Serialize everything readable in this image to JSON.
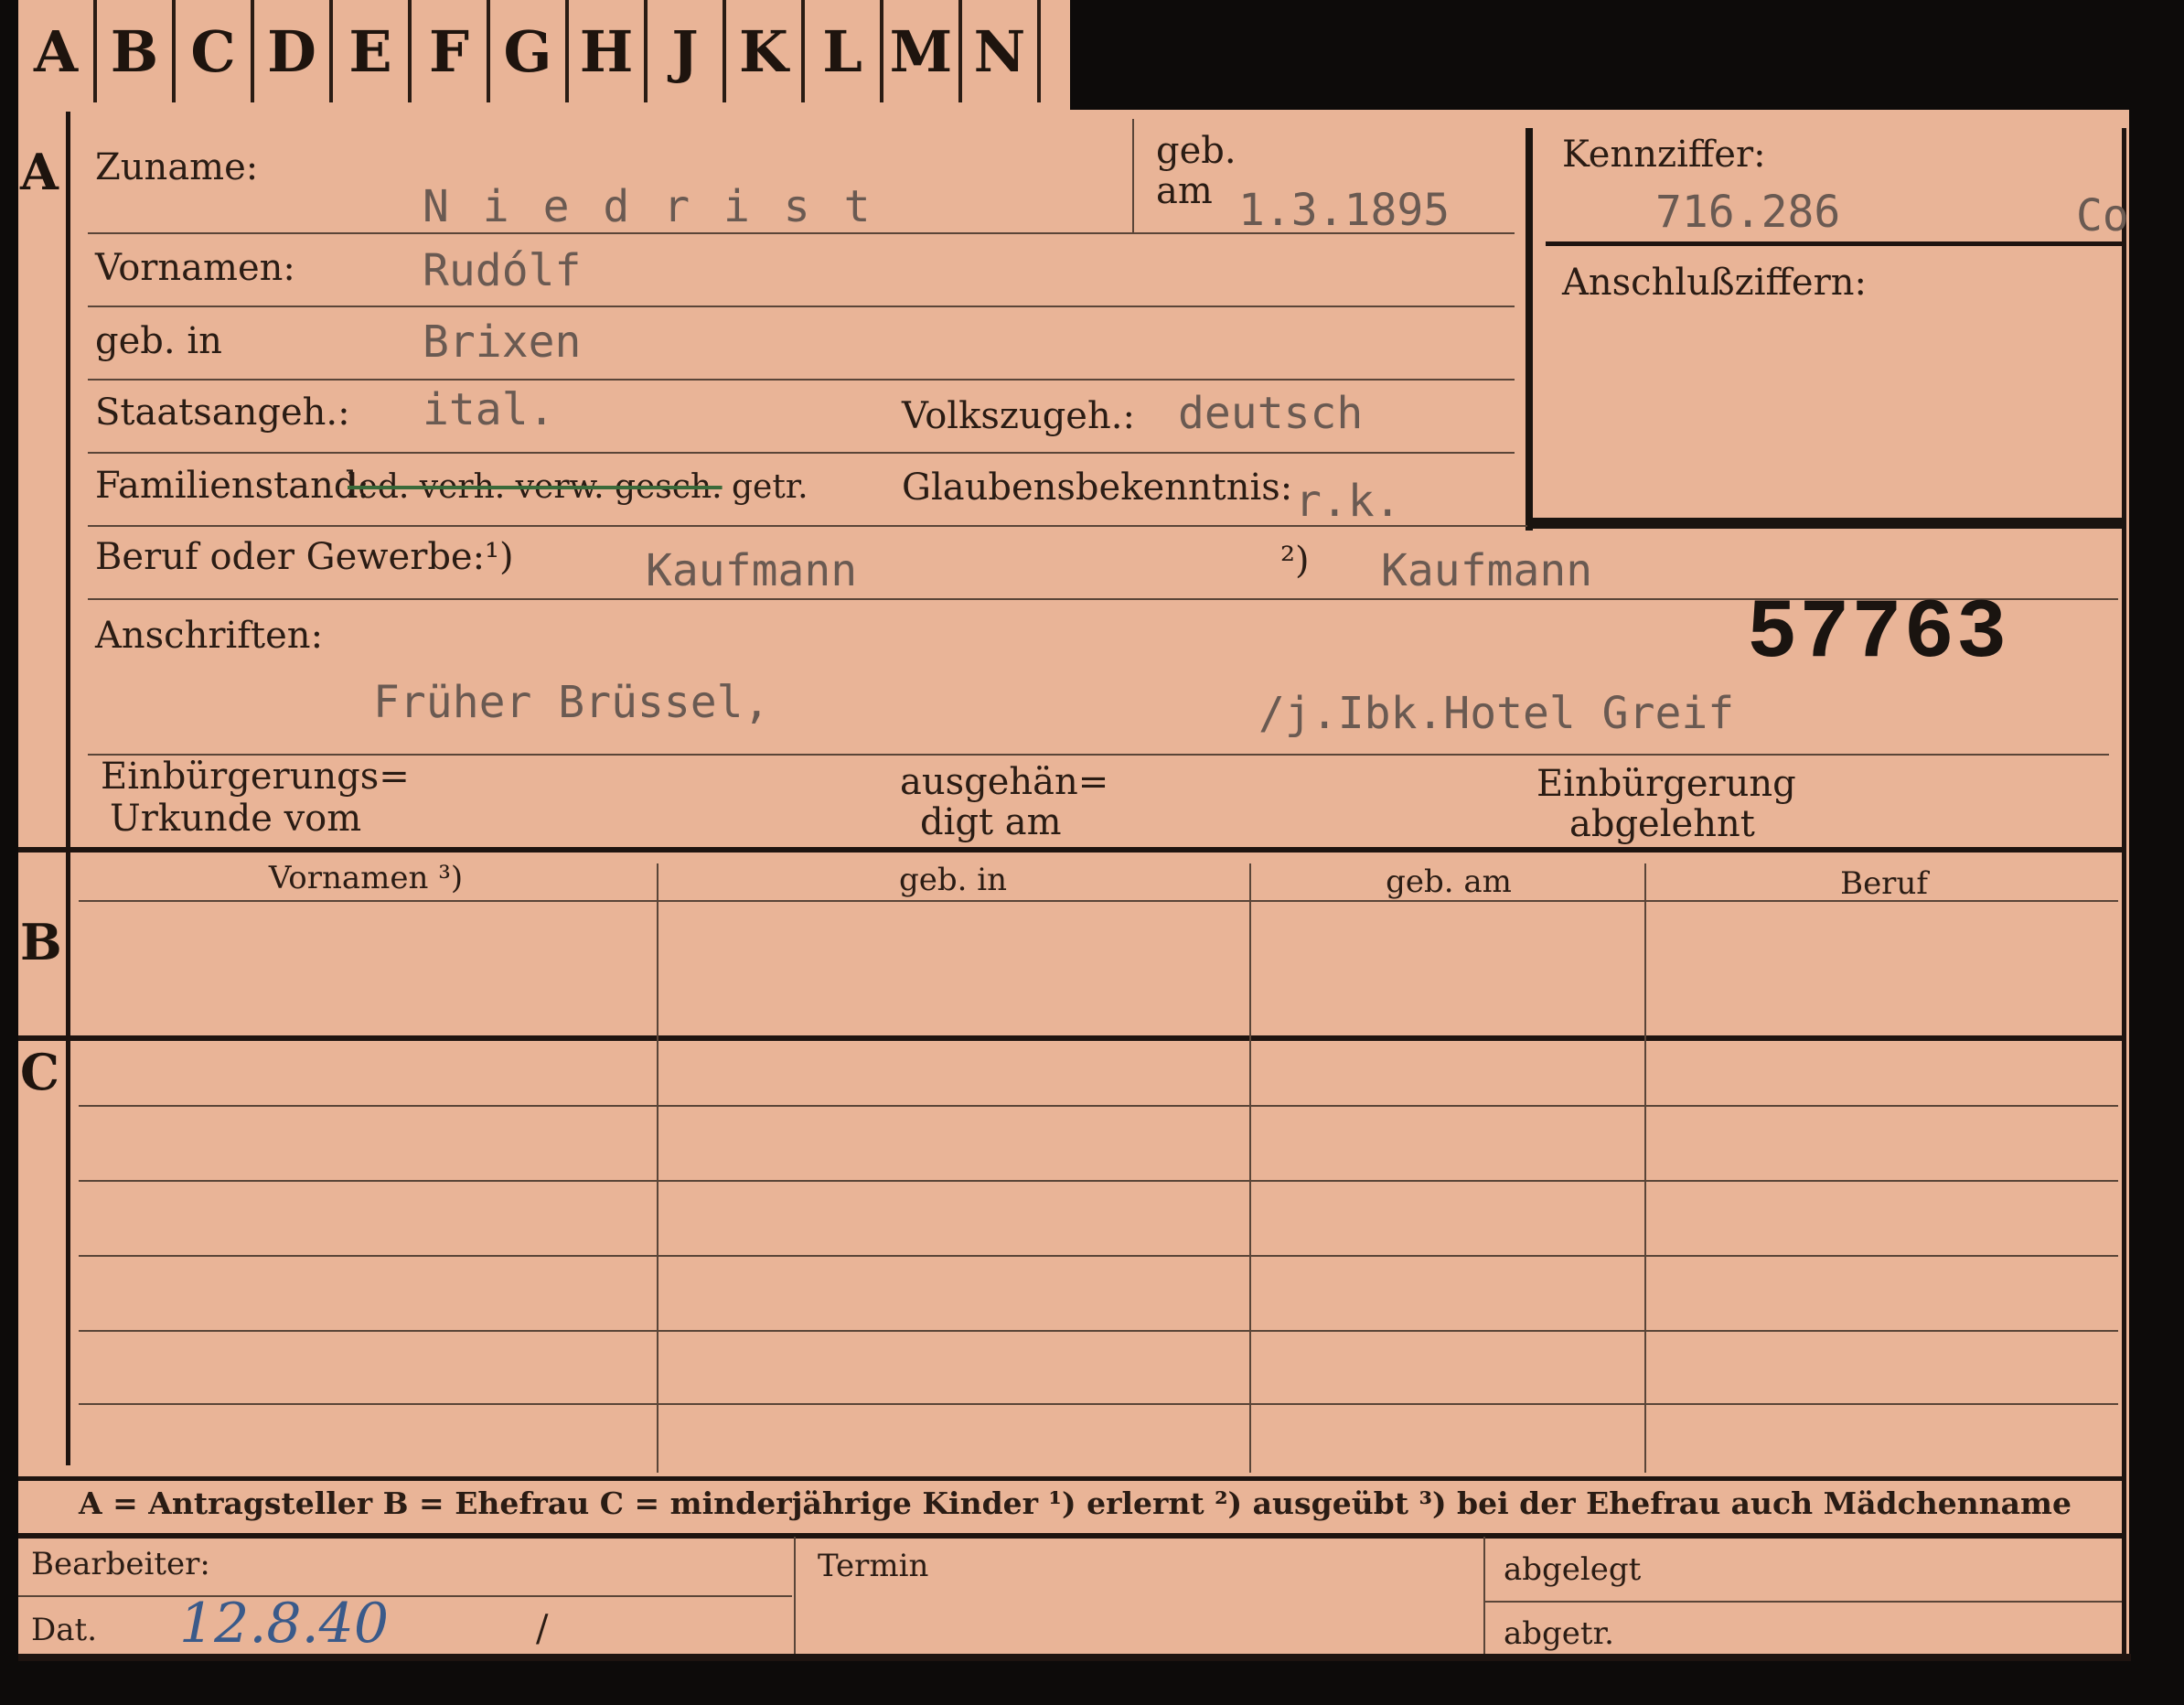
{
  "tabs": [
    "A",
    "B",
    "C",
    "D",
    "E",
    "F",
    "G",
    "H",
    "J",
    "K",
    "L",
    "M",
    "N"
  ],
  "sections": {
    "a": "A",
    "b": "B",
    "c": "C"
  },
  "person": {
    "zuname_label": "Zuname:",
    "zuname": "N i e d r i s t",
    "geb_label1": "geb.",
    "geb_label2": "am",
    "geb_am": "1.3.1895",
    "vornamen_label": "Vornamen:",
    "vornamen": "Rudólf",
    "geb_in_label": "geb. in",
    "geb_in": "Brixen",
    "staat_label": "Staatsangeh.:",
    "staat": "ital.",
    "volk_label": "Volkszugeh.:",
    "volk": "deutsch",
    "familie_label": "Familienstand:",
    "familie_struck": "led. verh. verw. gesch.",
    "familie_getr": "getr.",
    "glaube_label": "Glaubensbekenntnis:",
    "glaube": "r.k.",
    "beruf_label": "Beruf oder Gewerbe:",
    "beruf1_marker": "¹)",
    "beruf1": "Kaufmann",
    "beruf2_marker": "²)",
    "beruf2": "Kaufmann",
    "anschriften_label": "Anschriften:",
    "anschrift1": "Früher Brüssel,",
    "anschrift2": "/j.Ibk.Hotel Greif",
    "einb_label1": "Einbürgerungs=",
    "einb_label2": "Urkunde vom",
    "ausg_label1": "ausgehän=",
    "ausg_label2": "digt am",
    "abgel_label1": "Einbürgerung",
    "abgel_label2": "abgelehnt"
  },
  "kennziffer": {
    "label": "Kennziffer:",
    "value": "716.286",
    "suffix": "Co",
    "anschluss_label": "Anschlußziffern:"
  },
  "stamp_number": "57763",
  "table_b": {
    "headers": [
      "Vornamen ³)",
      "geb. in",
      "geb. am",
      "Beruf"
    ]
  },
  "legend": "A = Antragsteller   B = Ehefrau   C = minderjährige Kinder   ¹) erlernt   ²) ausgeübt   ³) bei der Ehefrau auch Mädchenname",
  "footer": {
    "bearbeiter_label": "Bearbeiter:",
    "dat_label": "Dat.",
    "dat_value": "12.8.40",
    "slash": "/",
    "termin_label": "Termin",
    "abgelegt_label": "abgelegt",
    "abgetr_label": "abgetr."
  }
}
